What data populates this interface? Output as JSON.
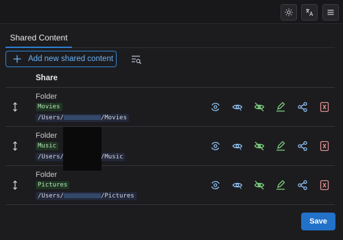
{
  "topbar": {
    "buttons": [
      {
        "icon": "sun-icon"
      },
      {
        "icon": "translate-icon"
      },
      {
        "icon": "menu-icon"
      }
    ]
  },
  "tabs": [
    {
      "label": "Shared Content",
      "active": true
    }
  ],
  "toolbar": {
    "add_label": "Add new shared content",
    "filter_icon": "filter-search-icon"
  },
  "table": {
    "header": "Share",
    "rows": [
      {
        "type": "Folder",
        "name": "Movies",
        "path_prefix": "/Users/",
        "path_suffix": "/Movies"
      },
      {
        "type": "Folder",
        "name": "Music",
        "path_prefix": "/Users/",
        "path_suffix": "/Music"
      },
      {
        "type": "Folder",
        "name": "Pictures",
        "path_prefix": "/Users/",
        "path_suffix": "/Pictures"
      }
    ],
    "action_icons": [
      "sync-eye-icon",
      "eye-icon",
      "eye-off-icon",
      "edit-icon",
      "share-icon",
      "delete-icon"
    ]
  },
  "footer": {
    "save_label": "Save"
  },
  "colors": {
    "accent": "#2272c9",
    "action_blue": "#8fc2f2",
    "action_green": "#7fd07f",
    "action_red": "#e08f8f"
  }
}
